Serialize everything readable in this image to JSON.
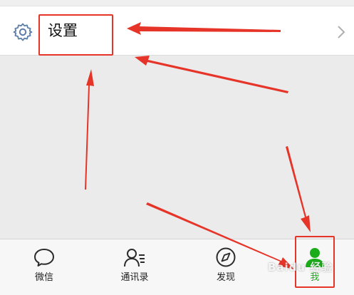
{
  "settings_row": {
    "icon": "gear-icon",
    "label": "设置",
    "chevron_icon": "chevron-right-icon"
  },
  "tabbar": {
    "tabs": [
      {
        "label": "微信",
        "icon": "chat-bubble-icon",
        "active": false
      },
      {
        "label": "通讯录",
        "icon": "contacts-icon",
        "active": false
      },
      {
        "label": "发现",
        "icon": "compass-icon",
        "active": false
      },
      {
        "label": "我",
        "icon": "person-icon",
        "active": true
      }
    ]
  },
  "watermark": {
    "text": "Baidu 经验"
  },
  "colors": {
    "annotation": "#e63428",
    "active_tab": "#1aad19",
    "icon_gray": "#6b7886",
    "background": "#ebebeb"
  }
}
